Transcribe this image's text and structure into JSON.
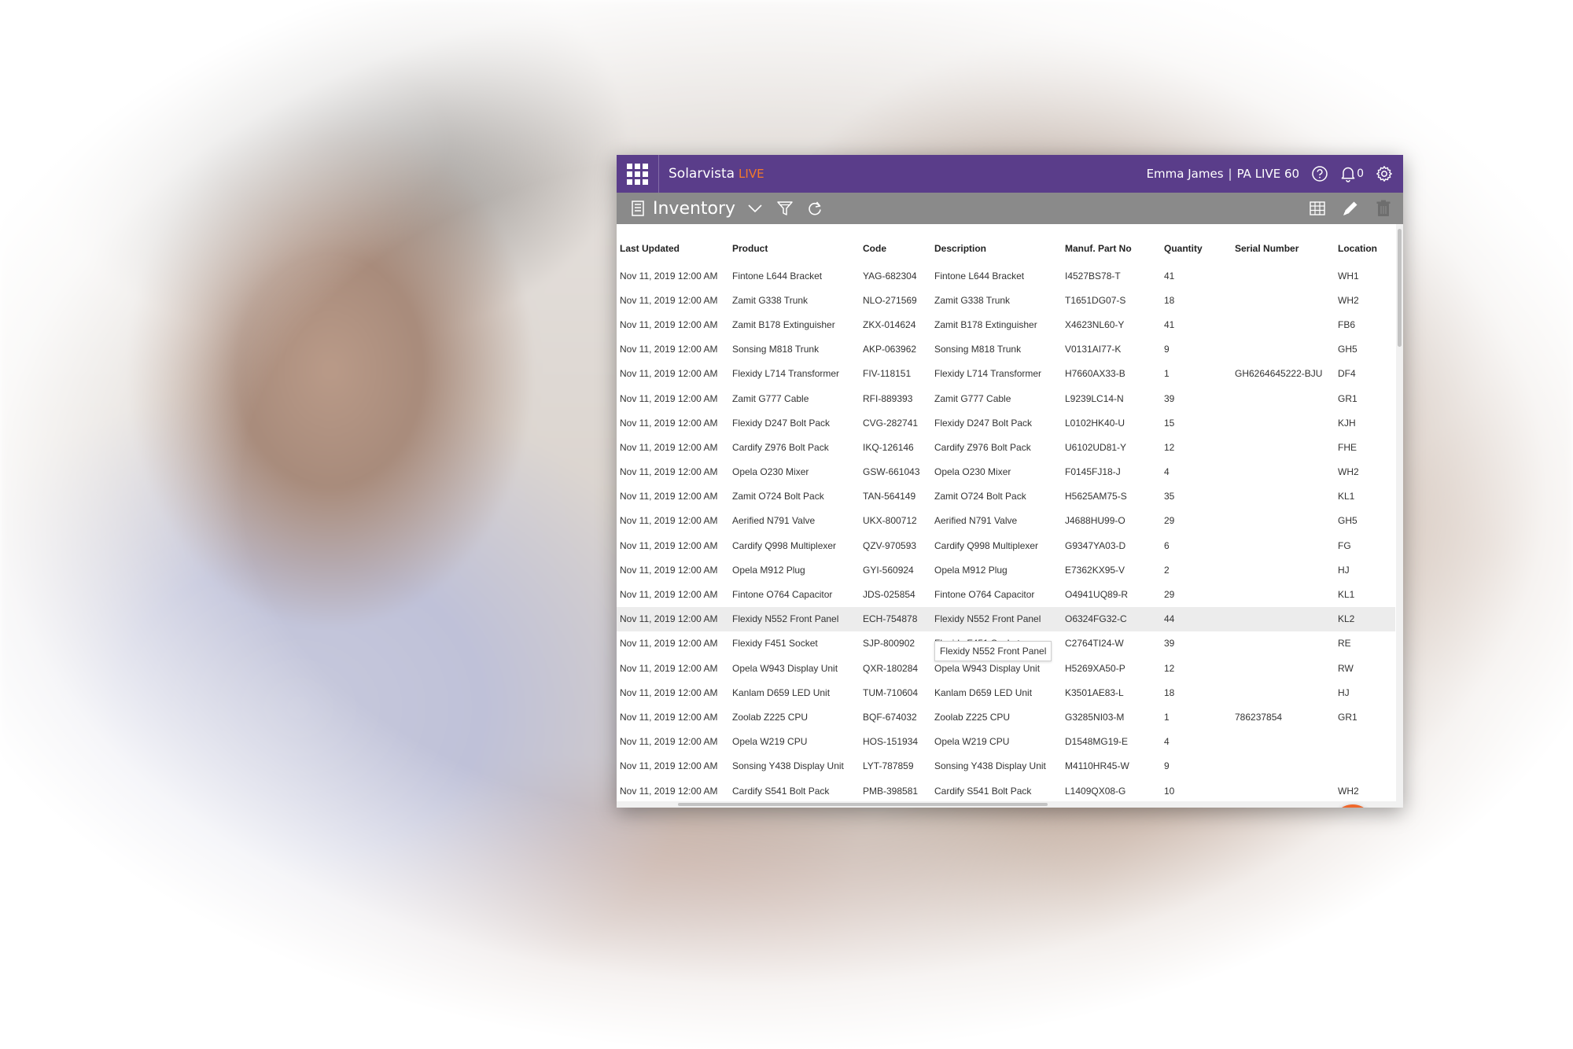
{
  "app": {
    "brand_name": "Solarvista",
    "brand_suffix": "LIVE",
    "user_name": "Emma James",
    "separator": "|",
    "workspace": "PA LIVE 60",
    "notification_count": "0",
    "colors": {
      "topbar": "#5a3d8a",
      "toolbar": "#8a8a8a",
      "accent": "#f47a2a",
      "fab": "#f0672a"
    }
  },
  "toolbar": {
    "title": "Inventory",
    "icons": [
      "inventory-icon",
      "chevron-down-icon",
      "filter-icon",
      "refresh-icon",
      "grid-view-icon",
      "edit-icon",
      "trash-icon"
    ]
  },
  "table": {
    "columns": [
      "Last Updated",
      "Product",
      "Code",
      "Description",
      "Manuf. Part No",
      "Quantity",
      "Serial Number",
      "Location"
    ],
    "rows": [
      [
        "Nov 11, 2019 12:00 AM",
        "Fintone L644 Bracket",
        "YAG-682304",
        "Fintone L644 Bracket",
        "I4527BS78-T",
        "41",
        "",
        "WH1"
      ],
      [
        "Nov 11, 2019 12:00 AM",
        "Zamit G338 Trunk",
        "NLO-271569",
        "Zamit G338 Trunk",
        "T1651DG07-S",
        "18",
        "",
        "WH2"
      ],
      [
        "Nov 11, 2019 12:00 AM",
        "Zamit B178 Extinguisher",
        "ZKX-014624",
        "Zamit B178 Extinguisher",
        "X4623NL60-Y",
        "41",
        "",
        "FB6"
      ],
      [
        "Nov 11, 2019 12:00 AM",
        "Sonsing M818 Trunk",
        "AKP-063962",
        "Sonsing M818 Trunk",
        "V0131AI77-K",
        "9",
        "",
        "GH5"
      ],
      [
        "Nov 11, 2019 12:00 AM",
        "Flexidy L714 Transformer",
        "FIV-118151",
        "Flexidy L714 Transformer",
        "H7660AX33-B",
        "1",
        "GH6264645222-BJU",
        "DF4"
      ],
      [
        "Nov 11, 2019 12:00 AM",
        "Zamit G777 Cable",
        "RFI-889393",
        "Zamit G777 Cable",
        "L9239LC14-N",
        "39",
        "",
        "GR1"
      ],
      [
        "Nov 11, 2019 12:00 AM",
        "Flexidy D247 Bolt Pack",
        "CVG-282741",
        "Flexidy D247 Bolt Pack",
        "L0102HK40-U",
        "15",
        "",
        "KJH"
      ],
      [
        "Nov 11, 2019 12:00 AM",
        "Cardify Z976 Bolt Pack",
        "IKQ-126146",
        "Cardify Z976 Bolt Pack",
        "U6102UD81-Y",
        "12",
        "",
        "FHE"
      ],
      [
        "Nov 11, 2019 12:00 AM",
        "Opela O230 Mixer",
        "GSW-661043",
        "Opela O230 Mixer",
        "F0145FJ18-J",
        "4",
        "",
        "WH2"
      ],
      [
        "Nov 11, 2019 12:00 AM",
        "Zamit O724 Bolt Pack",
        "TAN-564149",
        "Zamit O724 Bolt Pack",
        "H5625AM75-S",
        "35",
        "",
        "KL1"
      ],
      [
        "Nov 11, 2019 12:00 AM",
        "Aerified N791 Valve",
        "UKX-800712",
        "Aerified N791 Valve",
        "J4688HU99-O",
        "29",
        "",
        "GH5"
      ],
      [
        "Nov 11, 2019 12:00 AM",
        "Cardify Q998 Multiplexer",
        "QZV-970593",
        "Cardify Q998 Multiplexer",
        "G9347YA03-D",
        "6",
        "",
        "FG"
      ],
      [
        "Nov 11, 2019 12:00 AM",
        "Opela M912 Plug",
        "GYI-560924",
        "Opela M912 Plug",
        "E7362KX95-V",
        "2",
        "",
        "HJ"
      ],
      [
        "Nov 11, 2019 12:00 AM",
        "Fintone O764 Capacitor",
        "JDS-025854",
        "Fintone O764 Capacitor",
        "O4941UQ89-R",
        "29",
        "",
        "KL1"
      ],
      [
        "Nov 11, 2019 12:00 AM",
        "Flexidy N552 Front Panel",
        "ECH-754878",
        "Flexidy N552 Front Panel",
        "O6324FG32-C",
        "44",
        "",
        "KL2"
      ],
      [
        "Nov 11, 2019 12:00 AM",
        "Flexidy F451 Socket",
        "SJP-800902",
        "Flexidy F451 Socket",
        "C2764TI24-W",
        "39",
        "",
        "RE"
      ],
      [
        "Nov 11, 2019 12:00 AM",
        "Opela W943 Display Unit",
        "QXR-180284",
        "Opela W943 Display Unit",
        "H5269XA50-P",
        "12",
        "",
        "RW"
      ],
      [
        "Nov 11, 2019 12:00 AM",
        "Kanlam D659 LED Unit",
        "TUM-710604",
        "Kanlam D659 LED Unit",
        "K3501AE83-L",
        "18",
        "",
        "HJ"
      ],
      [
        "Nov 11, 2019 12:00 AM",
        "Zoolab Z225 CPU",
        "BQF-674032",
        "Zoolab Z225 CPU",
        "G3285NI03-M",
        "1",
        "786237854",
        "GR1"
      ],
      [
        "Nov 11, 2019 12:00 AM",
        "Opela W219 CPU",
        "HOS-151934",
        "Opela W219 CPU",
        "D1548MG19-E",
        "4",
        "",
        ""
      ],
      [
        "Nov 11, 2019 12:00 AM",
        "Sonsing Y438 Display Unit",
        "LYT-787859",
        "Sonsing Y438 Display Unit",
        "M4110HR45-W",
        "9",
        "",
        ""
      ],
      [
        "Nov 11, 2019 12:00 AM",
        "Cardify S541 Bolt Pack",
        "PMB-398581",
        "Cardify S541 Bolt Pack",
        "L1409QX08-G",
        "10",
        "",
        "WH2"
      ]
    ],
    "hover_row_index": 14,
    "tooltip": "Flexidy N552 Front Panel"
  },
  "fab": {
    "icon": "plus-icon"
  }
}
